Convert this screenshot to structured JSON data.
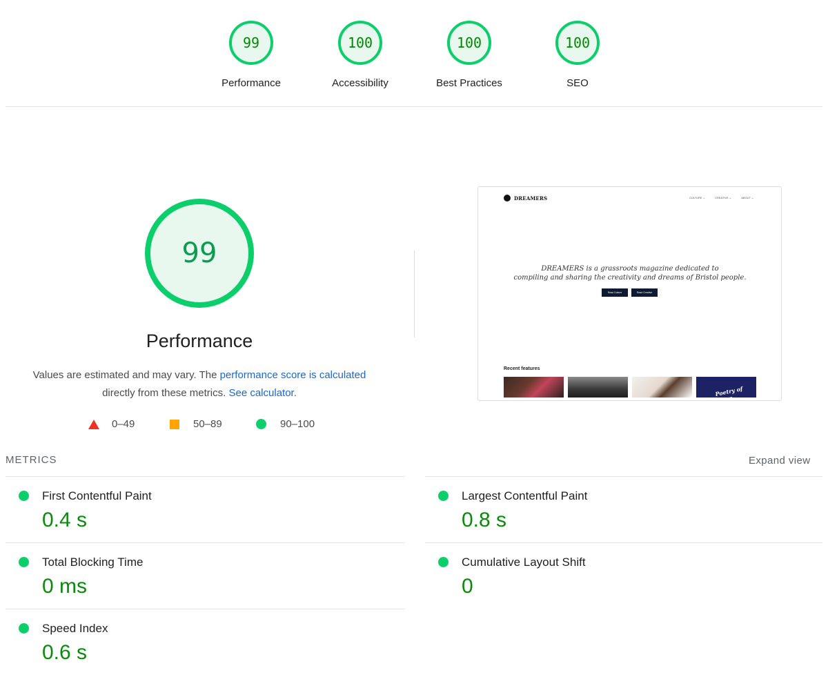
{
  "categories": [
    {
      "score": "99",
      "label": "Performance"
    },
    {
      "score": "100",
      "label": "Accessibility"
    },
    {
      "score": "100",
      "label": "Best Practices"
    },
    {
      "score": "100",
      "label": "SEO"
    }
  ],
  "performance": {
    "score": "99",
    "title": "Performance",
    "desc_prefix": "Values are estimated and may vary. The ",
    "desc_link1": "performance score is calculated",
    "desc_middle": "directly from these metrics. ",
    "desc_link2": "See calculator."
  },
  "legend": {
    "fail": "0–49",
    "average": "50–89",
    "pass": "90–100"
  },
  "screenshot": {
    "logo_text": "DREAMERS",
    "nav": [
      "CULTURE ⌄",
      "CREATIVE ⌄",
      "ABOUT ⌄"
    ],
    "tagline_line1": "DREAMERS is a grassroots magazine dedicated to",
    "tagline_line2": "compiling and sharing the creativity and dreams of Bristol people.",
    "button1": "Read Culture",
    "button2": "Read Creative",
    "recent_label": "Recent features",
    "img4_text": "Poetry of sleep"
  },
  "metrics": {
    "header": "METRICS",
    "expand_label": "Expand view",
    "items": [
      {
        "title": "First Contentful Paint",
        "value": "0.4 s"
      },
      {
        "title": "Largest Contentful Paint",
        "value": "0.8 s"
      },
      {
        "title": "Total Blocking Time",
        "value": "0 ms"
      },
      {
        "title": "Cumulative Layout Shift",
        "value": "0"
      },
      {
        "title": "Speed Index",
        "value": "0.6 s"
      }
    ]
  },
  "colors": {
    "pass": "#0cce6b",
    "average": "#ffa400",
    "fail": "#eb3223",
    "link": "#1a66d2"
  }
}
